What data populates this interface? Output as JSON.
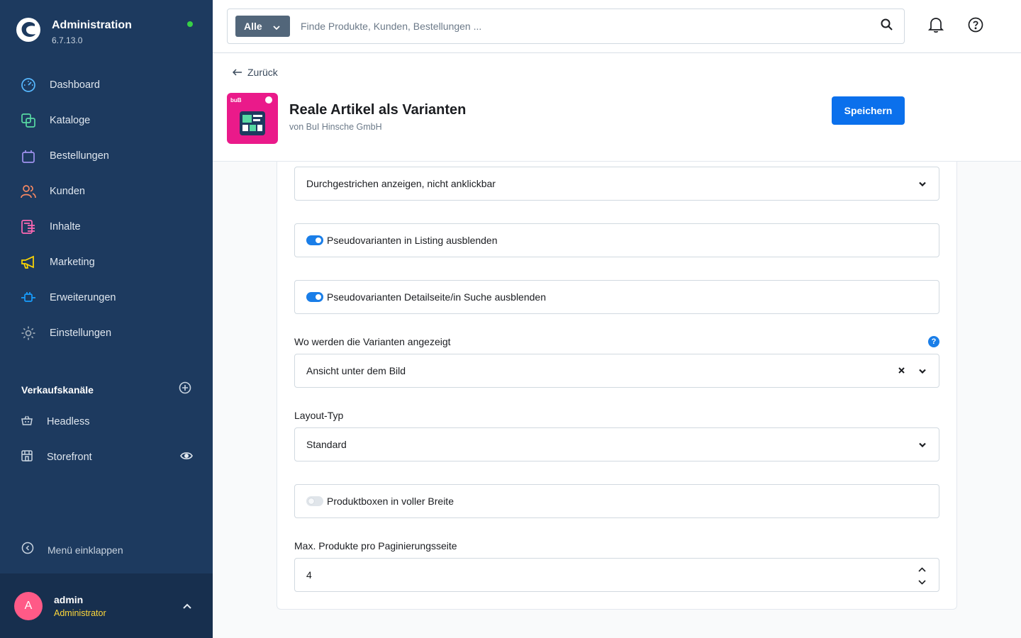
{
  "app": {
    "title": "Administration",
    "version": "6.7.13.0",
    "online_color": "#37d046"
  },
  "sidebar": {
    "items": [
      {
        "label": "Dashboard",
        "icon": "dashboard-icon",
        "color": "#57b8ff"
      },
      {
        "label": "Kataloge",
        "icon": "catalog-icon",
        "color": "#57d9a3"
      },
      {
        "label": "Bestellungen",
        "icon": "shopping-bag-icon",
        "color": "#a092f0"
      },
      {
        "label": "Kunden",
        "icon": "users-icon",
        "color": "#f88962"
      },
      {
        "label": "Inhalte",
        "icon": "content-icon",
        "color": "#ff68b4"
      },
      {
        "label": "Marketing",
        "icon": "megaphone-icon",
        "color": "#ffd700"
      },
      {
        "label": "Erweiterungen",
        "icon": "plug-icon",
        "color": "#189eff"
      },
      {
        "label": "Einstellungen",
        "icon": "gear-icon",
        "color": "#9aa8b5"
      }
    ],
    "sales_channels": {
      "title": "Verkaufskanäle",
      "items": [
        {
          "label": "Headless",
          "icon": "basket-icon"
        },
        {
          "label": "Storefront",
          "icon": "storefront-icon"
        }
      ]
    },
    "collapse_label": "Menü einklappen",
    "user": {
      "initial": "A",
      "name": "admin",
      "role": "Administrator"
    }
  },
  "search": {
    "type_label": "Alle",
    "placeholder": "Finde Produkte, Kunden, Bestellungen ..."
  },
  "header": {
    "back_label": "Zurück",
    "app_name": "Reale Artikel als Varianten",
    "vendor": "von BuI Hinsche GmbH",
    "icon_text": "buB",
    "save_label": "Speichern",
    "accent": "#0b70ec"
  },
  "form": {
    "display_select": "Durchgestrichen anzeigen, nicht anklickbar",
    "hide_listing": {
      "label": "Pseudovarianten in Listing ausblenden",
      "enabled": true
    },
    "hide_detail": {
      "label": "Pseudovarianten Detailseite/in Suche ausblenden",
      "enabled": true
    },
    "position_label": "Wo werden die Varianten angezeigt",
    "position_value": "Ansicht unter dem Bild",
    "help_icon": "?",
    "layout_label": "Layout-Typ",
    "layout_value": "Standard",
    "full_width": {
      "label": "Produktboxen in voller Breite",
      "enabled": false
    },
    "max_products_label": "Max. Produkte pro Paginierungsseite",
    "max_products_value": "4"
  }
}
